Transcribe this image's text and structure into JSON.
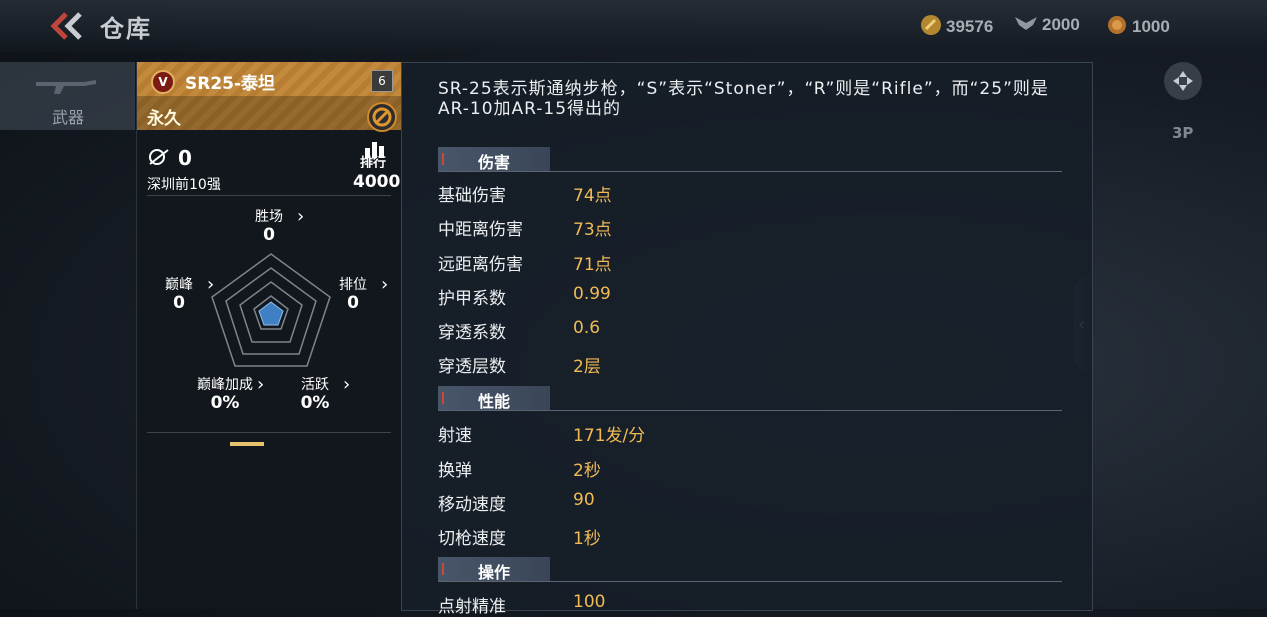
{
  "header": {
    "title": "仓库"
  },
  "currency": {
    "gold": "39576",
    "wings": "2000",
    "coins": "1000"
  },
  "sidebar": {
    "weapon_tab": "武器"
  },
  "right_controls": {
    "view_label": "3P"
  },
  "weapon": {
    "badge_letter": "V",
    "name": "SR25-泰坦",
    "level": "6",
    "duration": "永久",
    "kills": "0",
    "rank_text": "深圳前10强",
    "rank_label": "排行",
    "rank_value": "4000"
  },
  "radar": {
    "wins": {
      "label": "胜场",
      "value": "0"
    },
    "peak": {
      "label": "巅峰",
      "value": "0"
    },
    "ranked": {
      "label": "排位",
      "value": "0"
    },
    "peak_bonus": {
      "label": "巅峰加成",
      "value": "0%"
    },
    "activity": {
      "label": "活跃",
      "value": "0%"
    }
  },
  "description": "SR-25表示斯通纳步枪，“S”表示“Stoner”，“R”则是“Rifle”，而“25”则是AR-10加AR-15得出的",
  "sections": [
    {
      "title": "伤害",
      "rows": [
        {
          "label": "基础伤害",
          "value": "74点"
        },
        {
          "label": "中距离伤害",
          "value": "73点"
        },
        {
          "label": "远距离伤害",
          "value": "71点"
        },
        {
          "label": "护甲系数",
          "value": "0.99"
        },
        {
          "label": "穿透系数",
          "value": "0.6"
        },
        {
          "label": "穿透层数",
          "value": "2层"
        }
      ]
    },
    {
      "title": "性能",
      "rows": [
        {
          "label": "射速",
          "value": "171发/分"
        },
        {
          "label": "换弹",
          "value": "2秒"
        },
        {
          "label": "移动速度",
          "value": "90"
        },
        {
          "label": "切枪速度",
          "value": "1秒"
        }
      ]
    },
    {
      "title": "操作",
      "rows": [
        {
          "label": "点射精准",
          "value": "100"
        }
      ]
    }
  ],
  "colors": {
    "accent_gold": "#f0bb55",
    "header_orange": "#c38a3e",
    "radar_fill": "#3f7fc4"
  }
}
